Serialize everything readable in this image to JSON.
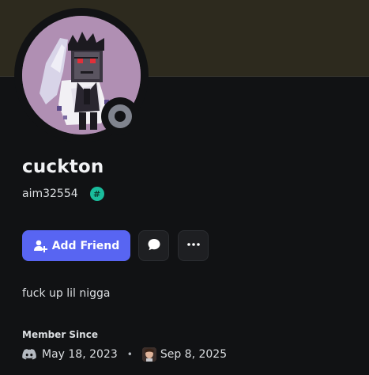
{
  "profile": {
    "display_name": "cuckton",
    "username": "aim32554",
    "tag_badge": "#",
    "status": "offline",
    "bio": "fuck up lil nigga"
  },
  "actions": {
    "add_friend_label": "Add Friend",
    "message_icon": "chat-bubble-icon",
    "more_icon": "more-dots-icon"
  },
  "member_since": {
    "heading": "Member Since",
    "discord_date": "May 18, 2023",
    "separator": "•",
    "server_date": "Sep 8, 2025"
  },
  "colors": {
    "banner": "#2d2a1e",
    "background": "#111214",
    "accent": "#5865f2",
    "badge": "#1abc9c",
    "status_offline": "#80848e",
    "avatar_bg": "#b08fb3"
  }
}
